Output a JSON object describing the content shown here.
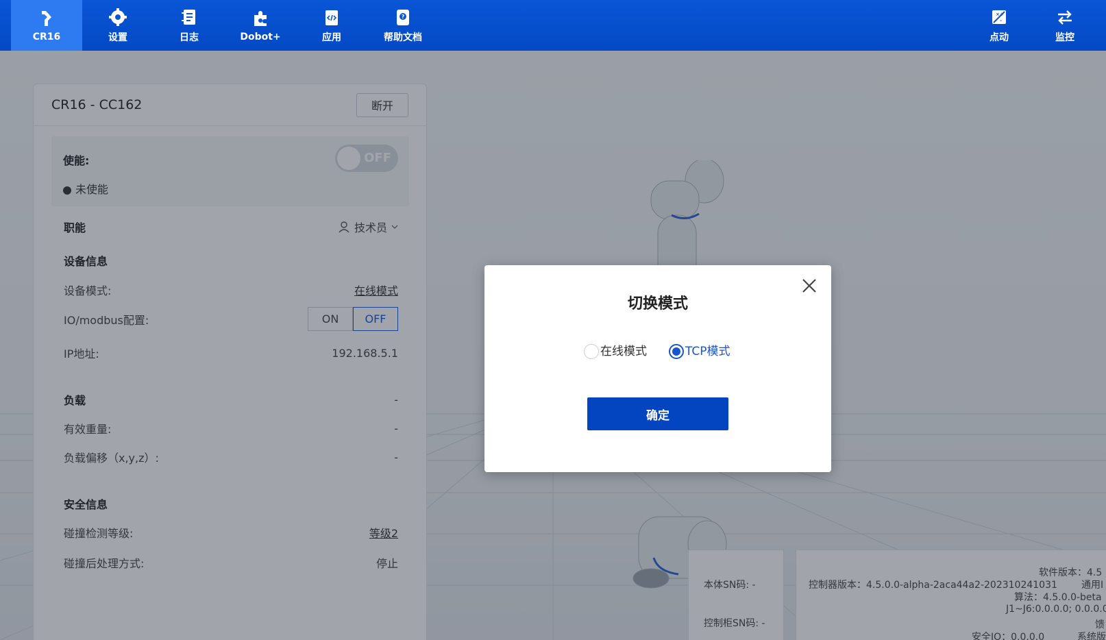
{
  "topnav": {
    "items": [
      {
        "label": "CR16",
        "icon": "robot-arm-icon",
        "active": true
      },
      {
        "label": "设置",
        "icon": "gear-icon"
      },
      {
        "label": "日志",
        "icon": "log-icon"
      },
      {
        "label": "Dobot+",
        "icon": "puzzle-icon"
      },
      {
        "label": "应用",
        "icon": "code-file-icon"
      },
      {
        "label": "帮助文档",
        "icon": "help-doc-icon"
      }
    ],
    "right_items": [
      {
        "label": "点动",
        "icon": "jog-icon"
      },
      {
        "label": "监控",
        "icon": "swap-arrows-icon"
      }
    ]
  },
  "panel": {
    "title": "CR16 - CC162",
    "disconnect_label": "断开",
    "enable": {
      "label": "使能:",
      "toggle_text": "OFF",
      "status": "未使能"
    },
    "role": {
      "label": "职能",
      "value": "技术员"
    },
    "device_info": {
      "heading": "设备信息",
      "mode_label": "设备模式:",
      "mode_value": "在线模式",
      "io_label": "IO/modbus配置:",
      "io_on": "ON",
      "io_off": "OFF",
      "ip_label": "IP地址:",
      "ip_value": "192.168.5.1"
    },
    "load": {
      "heading": "负载",
      "heading_value": "-",
      "weight_label": "有效重量:",
      "weight_value": "-",
      "offset_label": "负载偏移（x,y,z）:",
      "offset_value": "-"
    },
    "safety": {
      "heading": "安全信息",
      "collision_label": "碰撞检测等级:",
      "collision_value": "等级2",
      "after_label": "碰撞后处理方式:",
      "after_value": "停止"
    }
  },
  "info": {
    "body_sn": "本体SN码: -",
    "cabinet_sn": "控制柜SN码: -",
    "software_version": "软件版本：4.5",
    "controller_version": "控制器版本：4.5.0.0-alpha-2aca44a2-202310241031",
    "general": "通用I",
    "algorithm": "算法：4.5.0.0-beta",
    "joints": "J1~J6:0.0.0.0; 0.0.0.0",
    "feedback": "馈",
    "safety_io": "安全IO：0.0.0.0",
    "system": "系统版"
  },
  "modal": {
    "title": "切换模式",
    "options": [
      {
        "label": "在线模式",
        "selected": false
      },
      {
        "label": "TCP模式",
        "selected": true
      }
    ],
    "confirm_label": "确定"
  },
  "colors": {
    "primary": "#0345c0",
    "nav": "#0a56d6",
    "nav_active": "#2e7af0",
    "accent_blue": "#1756d0"
  }
}
